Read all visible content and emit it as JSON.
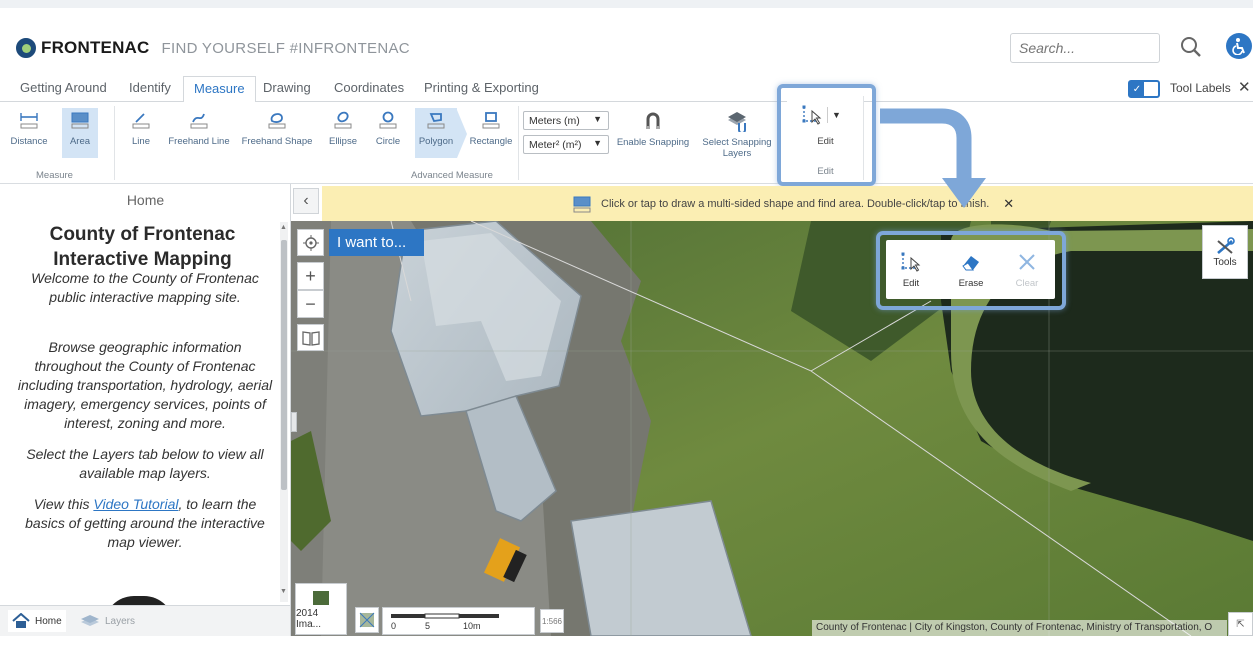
{
  "header": {
    "brand": "FRONTENAC",
    "tagline": "FIND YOURSELF #INFRONTENAC",
    "search_placeholder": "Search..."
  },
  "tabs": [
    {
      "label": "Getting Around"
    },
    {
      "label": "Identify"
    },
    {
      "label": "Measure",
      "active": true
    },
    {
      "label": "Drawing"
    },
    {
      "label": "Coordinates"
    },
    {
      "label": "Printing & Exporting"
    }
  ],
  "tool_labels_toggle": {
    "label": "Tool Labels",
    "checked": true
  },
  "ribbon": {
    "measure_group": {
      "label": "Measure",
      "tools": [
        {
          "label": "Distance"
        },
        {
          "label": "Area",
          "selected": true
        }
      ]
    },
    "advanced_group": {
      "label": "Advanced Measure",
      "tools": [
        {
          "label": "Line"
        },
        {
          "label": "Freehand Line"
        },
        {
          "label": "Freehand Shape"
        },
        {
          "label": "Ellipse"
        },
        {
          "label": "Circle"
        },
        {
          "label": "Polygon",
          "selected": true
        },
        {
          "label": "Rectangle"
        }
      ],
      "length_unit": "Meters (m)",
      "area_unit": "Meter² (m²)",
      "enable_snapping": "Enable Snapping",
      "select_snapping_layers": "Select Snapping Layers"
    },
    "edit_group": {
      "label": "Edit",
      "button": "Edit"
    }
  },
  "sidebar": {
    "panel_title": "Home",
    "title": "County of Frontenac Interactive Mapping",
    "p1": "Welcome to the County of Frontenac public interactive mapping site.",
    "p2": "Browse geographic information throughout the County of Frontenac including transportation, hydrology, aerial imagery, emergency services, points of interest, zoning and more.",
    "p3": "Select the Layers tab below to view all available map layers.",
    "p4_before": "View this ",
    "p4_link": "Video Tutorial",
    "p4_after": ", to learn the basics of getting around the interactive map viewer.",
    "bottom_tabs": [
      {
        "label": "Home"
      },
      {
        "label": "Layers"
      }
    ]
  },
  "map": {
    "message": "Click or tap to draw a multi-sided shape and find area. Double-click/tap to finish.",
    "i_want_to": "I want to...",
    "edit_popup": {
      "edit": "Edit",
      "erase": "Erase",
      "clear": "Clear"
    },
    "tools_label": "Tools",
    "imagery_label": "2014 Ima...",
    "scale_labels": [
      "0",
      "5",
      "10m"
    ],
    "scale_ratio": "1:566",
    "attribution": "County of Frontenac | City of Kingston, County of Frontenac, Ministry of Transportation, O"
  }
}
